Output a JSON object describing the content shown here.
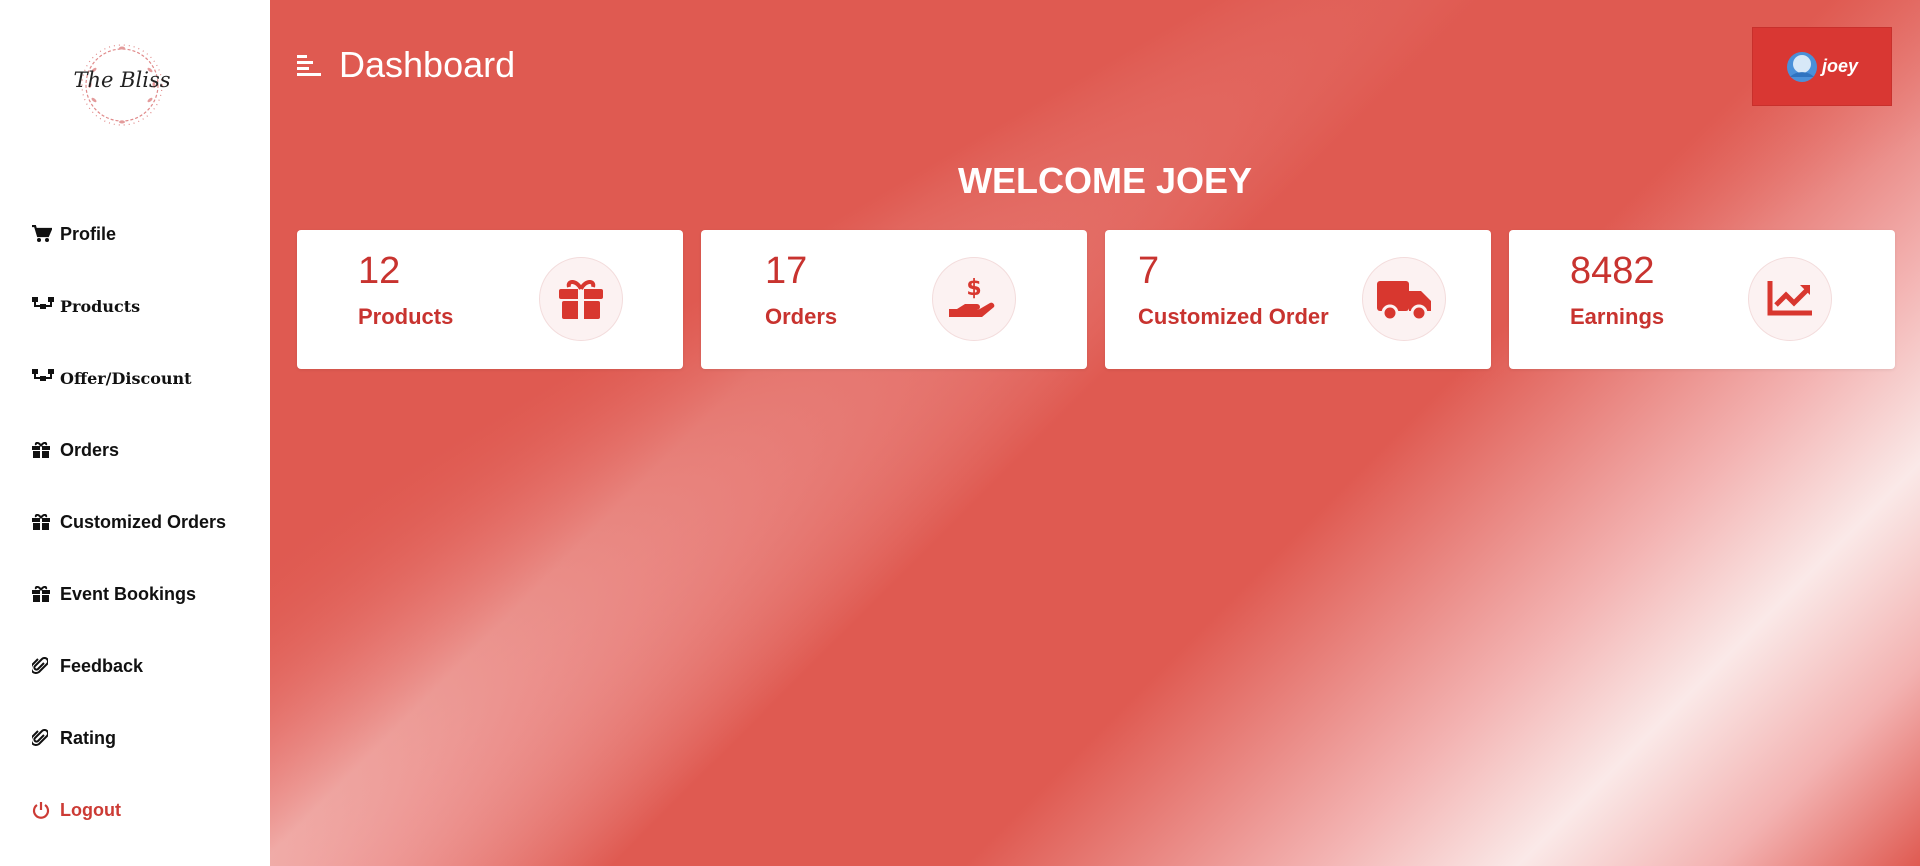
{
  "brand": {
    "logo_text": "The Bliss"
  },
  "sidebar": {
    "items": [
      {
        "label": "Profile",
        "icon": "cart-icon"
      },
      {
        "label": "Products",
        "icon": "sitemap-icon"
      },
      {
        "label": "Offer/Discount",
        "icon": "sitemap-icon"
      },
      {
        "label": "Orders",
        "icon": "gift-icon"
      },
      {
        "label": "Customized Orders",
        "icon": "gift-icon"
      },
      {
        "label": "Event Bookings",
        "icon": "gift-icon"
      },
      {
        "label": "Feedback",
        "icon": "paperclip-icon"
      },
      {
        "label": "Rating",
        "icon": "paperclip-icon"
      },
      {
        "label": "Logout",
        "icon": "power-icon"
      }
    ]
  },
  "header": {
    "title": "Dashboard",
    "user": "joey"
  },
  "welcome": "WELCOME JOEY",
  "stats": [
    {
      "value": "12",
      "label": "Products",
      "icon": "gift-icon"
    },
    {
      "value": "17",
      "label": "Orders",
      "icon": "hand-dollar-icon"
    },
    {
      "value": "7",
      "label": "Customized Order",
      "icon": "truck-icon"
    },
    {
      "value": "8482",
      "label": "Earnings",
      "icon": "chart-line-icon"
    }
  ],
  "colors": {
    "accent": "#df5a51",
    "accent_dark": "#c8332f",
    "button": "#d93733"
  }
}
